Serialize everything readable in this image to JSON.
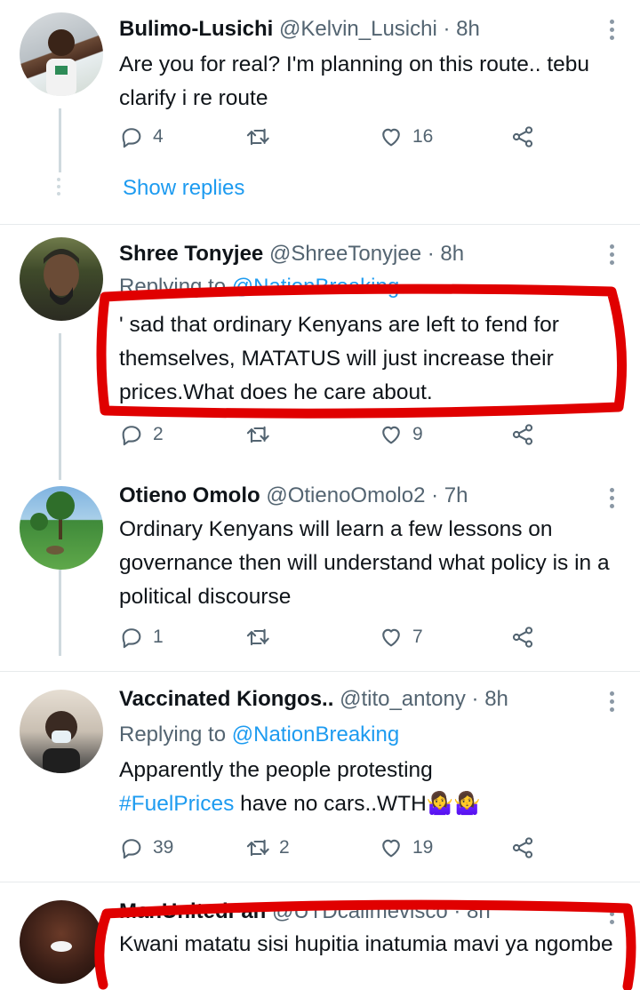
{
  "tweets": [
    {
      "name": "Bulimo-Lusichi",
      "handle": "@Kelvin_Lusichi",
      "time": "· 8h",
      "text": "Are you for real? I'm planning on this route.. tebu clarify i re route",
      "replies": "4",
      "retweets": "",
      "likes": "16",
      "show_replies": "Show replies"
    },
    {
      "name": "Shree Tonyjee",
      "handle": "@ShreeTonyjee",
      "time": "· 8h",
      "replying_prefix": "Replying to",
      "replying_to": "@NationBreaking",
      "text": "' sad that ordinary Kenyans are left to fend for themselves, MATATUS will just increase their prices.What does he care about.",
      "replies": "2",
      "retweets": "",
      "likes": "9"
    },
    {
      "name": "Otieno Omolo",
      "handle": "@OtienoOmolo2",
      "time": "· 7h",
      "text": "Ordinary Kenyans will learn a few lessons on governance then will understand what policy is in a political discourse",
      "replies": "1",
      "retweets": "",
      "likes": "7"
    },
    {
      "name": "Vaccinated Kiongos..",
      "handle": "@tito_antony",
      "time": "· 8h",
      "replying_prefix": "Replying to",
      "replying_to": "@NationBreaking",
      "text_before": "Apparently the people protesting",
      "hashtag": "#FuelPrices",
      "text_after": " have no cars..WTH🤷‍♀️🤷‍♀️",
      "replies": "39",
      "retweets": "2",
      "likes": "19"
    },
    {
      "name": "ManUnitedFan",
      "handle": "@UTDcallmevisco",
      "time": "· 8h",
      "text": "Kwani matatu sisi hupitia inatumia mavi ya ngombe"
    }
  ],
  "icons": {
    "reply": "reply-icon",
    "retweet": "retweet-icon",
    "like": "heart-icon",
    "share": "share-icon",
    "more": "more-icon"
  },
  "colors": {
    "accent": "#1d9bf0",
    "text": "#0f1419",
    "muted": "#536471",
    "highlight": "#e00000"
  }
}
